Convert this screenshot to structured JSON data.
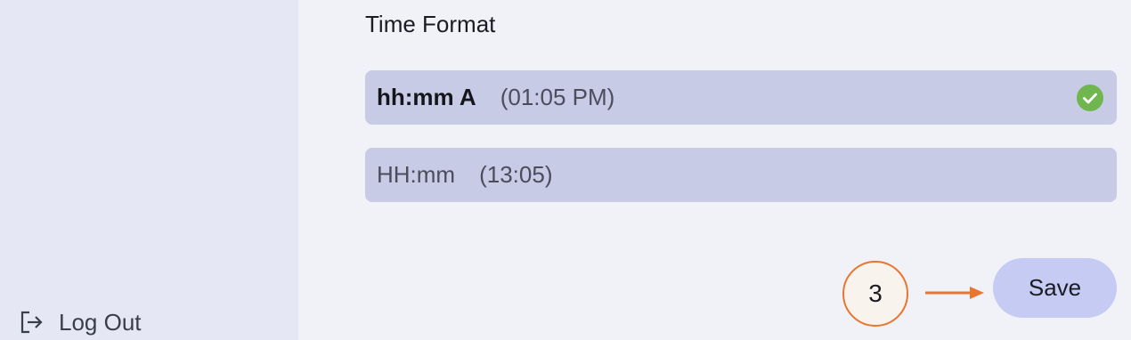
{
  "sidebar": {
    "logout": {
      "label": "Log Out",
      "icon": "logout-icon"
    }
  },
  "time_format": {
    "title": "Time Format",
    "options": [
      {
        "format": "hh:mm A",
        "example": "(01:05 PM)",
        "selected": true
      },
      {
        "format": "HH:mm",
        "example": "(13:05)",
        "selected": false
      }
    ]
  },
  "annotation": {
    "step": "3",
    "color": "#e8762f"
  },
  "actions": {
    "save_label": "Save"
  },
  "colors": {
    "accent": "#c6cbf4",
    "option_bg": "#c8cbe6",
    "check": "#6fb64e"
  }
}
